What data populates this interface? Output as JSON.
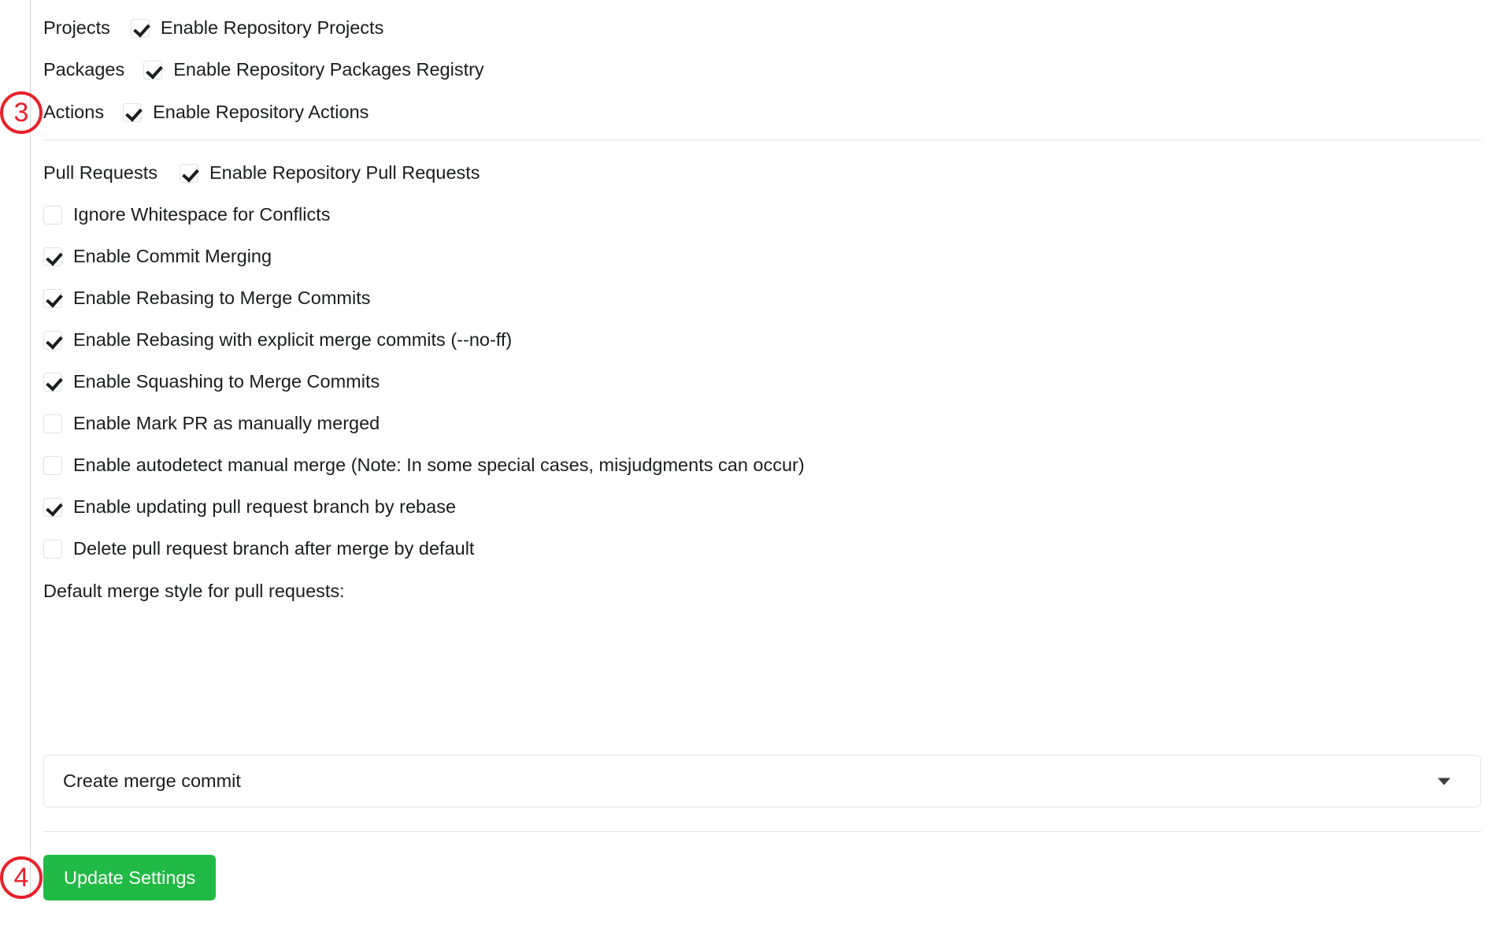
{
  "panel": {
    "inline_settings": [
      {
        "label": "Projects",
        "checkbox_label": "Enable Repository Projects",
        "checked": true,
        "gap": 26
      },
      {
        "label": "Packages",
        "checkbox_label": "Enable Repository Packages Registry",
        "checked": true,
        "gap": 24
      },
      {
        "label": "Actions",
        "checkbox_label": "Enable Repository Actions",
        "checked": true,
        "gap": 24
      }
    ],
    "pull_requests": {
      "label": "Pull Requests",
      "checkbox_label": "Enable Repository Pull Requests",
      "checked": true,
      "options": [
        {
          "label": "Ignore Whitespace for Conflicts",
          "checked": false
        },
        {
          "label": "Enable Commit Merging",
          "checked": true
        },
        {
          "label": "Enable Rebasing to Merge Commits",
          "checked": true
        },
        {
          "label": "Enable Rebasing with explicit merge commits (--no-ff)",
          "checked": true
        },
        {
          "label": "Enable Squashing to Merge Commits",
          "checked": true
        },
        {
          "label": "Enable Mark PR as manually merged",
          "checked": false
        },
        {
          "label": "Enable autodetect manual merge (Note: In some special cases, misjudgments can occur)",
          "checked": false
        },
        {
          "label": "Enable updating pull request branch by rebase",
          "checked": true
        },
        {
          "label": "Delete pull request branch after merge by default",
          "checked": false
        }
      ]
    },
    "merge_style": {
      "label": "Default merge style for pull requests:",
      "selected": "Create merge commit",
      "caret_icon": "chevron-down-icon"
    },
    "submit": {
      "label": "Update Settings",
      "color": "#21ba45"
    }
  },
  "annotations": [
    {
      "number": "3",
      "color": "#e8202a"
    },
    {
      "number": "4",
      "color": "#e8202a"
    }
  ]
}
